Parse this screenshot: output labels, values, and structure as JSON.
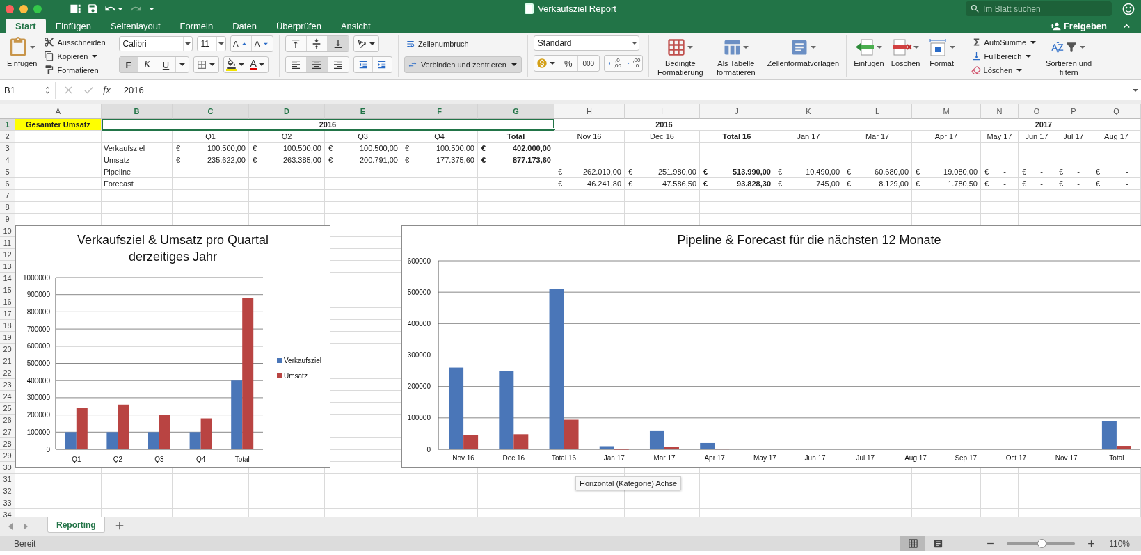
{
  "window": {
    "title": "Verkaufsziel Report"
  },
  "search": {
    "placeholder": "Im Blatt suchen"
  },
  "tabs": [
    {
      "label": "Start",
      "selected": true
    },
    {
      "label": "Einfügen",
      "selected": false
    },
    {
      "label": "Seitenlayout",
      "selected": false
    },
    {
      "label": "Formeln",
      "selected": false
    },
    {
      "label": "Daten",
      "selected": false
    },
    {
      "label": "Überprüfen",
      "selected": false
    },
    {
      "label": "Ansicht",
      "selected": false
    }
  ],
  "share": {
    "label": "Freigeben"
  },
  "ribbon": {
    "clipboard": {
      "paste": "Einfügen",
      "items": [
        {
          "label": "Ausschneiden",
          "kind": "plain"
        },
        {
          "label": "Kopieren",
          "kind": "menu"
        },
        {
          "label": "Formatieren",
          "kind": "plain"
        }
      ]
    },
    "font": {
      "name": "Calibri",
      "size": "11",
      "grow": "A",
      "shrink": "A",
      "styles": [
        {
          "label": "F",
          "selected": true
        },
        {
          "label": "K",
          "selected": false
        },
        {
          "label": "U",
          "selected": false
        }
      ],
      "font_color": "A"
    },
    "alignment": {
      "vertical": [
        {
          "selected": false
        },
        {
          "selected": false
        },
        {
          "selected": true
        }
      ],
      "horizontal": [
        {
          "selected": false
        },
        {
          "selected": true
        },
        {
          "selected": false
        }
      ]
    },
    "wrap": {
      "label": "Zeilenumbruch"
    },
    "merge": {
      "label": "Verbinden und zentrieren",
      "selected": true
    },
    "number": {
      "format": "Standard",
      "percent": "%",
      "thousands": "000",
      "decimals": [
        {
          "top": ",0",
          "bottom": ",00"
        },
        {
          "top": ",00",
          "bottom": ",0"
        }
      ]
    },
    "styles": [
      {
        "label": "Bedingte Formatierung"
      },
      {
        "label": "Als Tabelle formatieren"
      },
      {
        "label": "Zellenformatvorlagen"
      }
    ],
    "cells": [
      {
        "label": "Einfügen"
      },
      {
        "label": "Löschen"
      },
      {
        "label": "Format"
      }
    ],
    "editing": {
      "items": [
        {
          "label": "AutoSumme"
        },
        {
          "label": "Füllbereich"
        },
        {
          "label": "Löschen"
        }
      ],
      "sort": "Sortieren und filtern"
    }
  },
  "formula_bar": {
    "name_box": "B1",
    "fx": "fx",
    "value": "2016"
  },
  "sheet": {
    "columns": [
      {
        "label": "A",
        "selected": false
      },
      {
        "label": "B",
        "selected": true
      },
      {
        "label": "C",
        "selected": true
      },
      {
        "label": "D",
        "selected": true
      },
      {
        "label": "E",
        "selected": true
      },
      {
        "label": "F",
        "selected": true
      },
      {
        "label": "G",
        "selected": true
      },
      {
        "label": "H",
        "selected": false
      },
      {
        "label": "I",
        "selected": false
      },
      {
        "label": "J",
        "selected": false
      },
      {
        "label": "K",
        "selected": false
      },
      {
        "label": "L",
        "selected": false
      },
      {
        "label": "M",
        "selected": false
      },
      {
        "label": "N",
        "selected": false
      },
      {
        "label": "O",
        "selected": false
      },
      {
        "label": "P",
        "selected": false
      },
      {
        "label": "Q",
        "selected": false
      }
    ],
    "row_headers": [
      {
        "label": "1",
        "selected": true
      },
      {
        "label": "2",
        "selected": false
      },
      {
        "label": "3",
        "selected": false
      },
      {
        "label": "4",
        "selected": false
      },
      {
        "label": "5",
        "selected": false
      },
      {
        "label": "6",
        "selected": false
      },
      {
        "label": "7",
        "selected": false
      },
      {
        "label": "8",
        "selected": false
      },
      {
        "label": "9",
        "selected": false
      },
      {
        "label": "10",
        "selected": false
      },
      {
        "label": "11",
        "selected": false
      },
      {
        "label": "12",
        "selected": false
      },
      {
        "label": "13",
        "selected": false
      },
      {
        "label": "14",
        "selected": false
      },
      {
        "label": "15",
        "selected": false
      },
      {
        "label": "16",
        "selected": false
      },
      {
        "label": "17",
        "selected": false
      },
      {
        "label": "18",
        "selected": false
      },
      {
        "label": "19",
        "selected": false
      },
      {
        "label": "20",
        "selected": false
      },
      {
        "label": "21",
        "selected": false
      },
      {
        "label": "22",
        "selected": false
      },
      {
        "label": "23",
        "selected": false
      },
      {
        "label": "24",
        "selected": false
      },
      {
        "label": "25",
        "selected": false
      },
      {
        "label": "26",
        "selected": false
      },
      {
        "label": "27",
        "selected": false
      },
      {
        "label": "28",
        "selected": false
      },
      {
        "label": "29",
        "selected": false
      },
      {
        "label": "30",
        "selected": false
      },
      {
        "label": "31",
        "selected": false
      },
      {
        "label": "32",
        "selected": false
      },
      {
        "label": "33",
        "selected": false
      },
      {
        "label": "34",
        "selected": false
      }
    ],
    "band": {
      "label": "Gesamter Umsatz",
      "groups": [
        {
          "text": "2016",
          "selected": true
        },
        {
          "text": "2016",
          "selected": false
        },
        {
          "text": "2017",
          "selected": false
        }
      ]
    },
    "quarter_headers": [
      {
        "text": "Q1",
        "bold": false
      },
      {
        "text": "Q2",
        "bold": false
      },
      {
        "text": "Q3",
        "bold": false
      },
      {
        "text": "Q4",
        "bold": false
      },
      {
        "text": "Total",
        "bold": true
      }
    ],
    "month_headers": [
      {
        "text": "Nov 16",
        "bold": false
      },
      {
        "text": "Dec 16",
        "bold": false
      },
      {
        "text": "Total 16",
        "bold": true
      },
      {
        "text": "Jan 17",
        "bold": false
      },
      {
        "text": "Mar 17",
        "bold": false
      },
      {
        "text": "Apr 17",
        "bold": false
      },
      {
        "text": "May 17",
        "bold": false
      },
      {
        "text": "Jun 17",
        "bold": false
      },
      {
        "text": "Jul 17",
        "bold": false
      },
      {
        "text": "Aug 17",
        "bold": false
      }
    ],
    "rows": [
      {
        "label": "Verkaufsziel",
        "quarters": [
          {
            "kind": "amount",
            "currency": "€",
            "amount": "100.500,00",
            "bold": false
          },
          {
            "kind": "amount",
            "currency": "€",
            "amount": "100.500,00",
            "bold": false
          },
          {
            "kind": "amount",
            "currency": "€",
            "amount": "100.500,00",
            "bold": false
          },
          {
            "kind": "amount",
            "currency": "€",
            "amount": "100.500,00",
            "bold": false
          },
          {
            "kind": "amount",
            "currency": "€",
            "amount": "402.000,00",
            "bold": true
          }
        ]
      },
      {
        "label": "Umsatz",
        "quarters": [
          {
            "kind": "amount",
            "currency": "€",
            "amount": "235.622,00",
            "bold": false
          },
          {
            "kind": "amount",
            "currency": "€",
            "amount": "263.385,00",
            "bold": false
          },
          {
            "kind": "amount",
            "currency": "€",
            "amount": "200.791,00",
            "bold": false
          },
          {
            "kind": "amount",
            "currency": "€",
            "amount": "177.375,60",
            "bold": false
          },
          {
            "kind": "amount",
            "currency": "€",
            "amount": "877.173,60",
            "bold": true
          }
        ]
      },
      {
        "label": "Pipeline",
        "months": [
          {
            "kind": "amount",
            "currency": "€",
            "amount": "262.010,00",
            "bold": false
          },
          {
            "kind": "amount",
            "currency": "€",
            "amount": "251.980,00",
            "bold": false
          },
          {
            "kind": "amount",
            "currency": "€",
            "amount": "513.990,00",
            "bold": true
          },
          {
            "kind": "amount",
            "currency": "€",
            "amount": "10.490,00",
            "bold": false
          },
          {
            "kind": "amount",
            "currency": "€",
            "amount": "60.680,00",
            "bold": false
          },
          {
            "kind": "amount",
            "currency": "€",
            "amount": "19.080,00",
            "bold": false
          },
          {
            "kind": "nil",
            "currency": "€",
            "amount": "-",
            "bold": false
          },
          {
            "kind": "nil",
            "currency": "€",
            "amount": "-",
            "bold": false
          },
          {
            "kind": "nil",
            "currency": "€",
            "amount": "-",
            "bold": false
          },
          {
            "kind": "nil",
            "currency": "€",
            "amount": "-",
            "bold": false
          }
        ]
      },
      {
        "label": "Forecast",
        "months": [
          {
            "kind": "amount",
            "currency": "€",
            "amount": "46.241,80",
            "bold": false
          },
          {
            "kind": "amount",
            "currency": "€",
            "amount": "47.586,50",
            "bold": false
          },
          {
            "kind": "amount",
            "currency": "€",
            "amount": "93.828,30",
            "bold": true
          },
          {
            "kind": "amount",
            "currency": "€",
            "amount": "745,00",
            "bold": false
          },
          {
            "kind": "amount",
            "currency": "€",
            "amount": "8.129,00",
            "bold": false
          },
          {
            "kind": "amount",
            "currency": "€",
            "amount": "1.780,50",
            "bold": false
          },
          {
            "kind": "nil",
            "currency": "€",
            "amount": "-",
            "bold": false
          },
          {
            "kind": "nil",
            "currency": "€",
            "amount": "-",
            "bold": false
          },
          {
            "kind": "nil",
            "currency": "€",
            "amount": "-",
            "bold": false
          },
          {
            "kind": "nil",
            "currency": "€",
            "amount": "-",
            "bold": false
          }
        ]
      }
    ]
  },
  "charts": [
    {
      "chart_data": {
        "type": "bar",
        "title": "Verkaufsziel & Umsatz pro Quartal derzeitiges Jahr",
        "categories": [
          "Q1",
          "Q2",
          "Q3",
          "Q4",
          "Total"
        ],
        "series": [
          {
            "name": "Verkaufsziel",
            "color": "#4a76b8",
            "values": [
              100000,
              100000,
              100000,
              100000,
              400000
            ]
          },
          {
            "name": "Umsatz",
            "color": "#b94442",
            "values": [
              240000,
              260000,
              200000,
              180000,
              880000
            ]
          }
        ],
        "ylim": [
          0,
          1000000
        ],
        "yticks": [
          0,
          100000,
          200000,
          300000,
          400000,
          500000,
          600000,
          700000,
          800000,
          900000,
          1000000
        ],
        "grid": true,
        "legend": true
      }
    },
    {
      "chart_data": {
        "type": "bar",
        "title": "Pipeline & Forecast für die nächsten 12 Monate",
        "categories": [
          "Nov 16",
          "Dec 16",
          "Total 16",
          "Jan 17",
          "Mar 17",
          "Apr 17",
          "May 17",
          "Jun 17",
          "Jul 17",
          "Aug 17",
          "Sep 17",
          "Oct 17",
          "Nov 17",
          "Total"
        ],
        "series": [
          {
            "color": "#4a76b8",
            "values": [
              260000,
              250000,
              510000,
              10000,
              60000,
              20000,
              0,
              0,
              0,
              0,
              0,
              0,
              0,
              90000
            ]
          },
          {
            "color": "#b94442",
            "values": [
              46000,
              48000,
              94000,
              1000,
              8000,
              2000,
              0,
              0,
              0,
              0,
              0,
              0,
              0,
              11000
            ]
          }
        ],
        "ylim": [
          0,
          600000
        ],
        "yticks": [
          0,
          100000,
          200000,
          300000,
          400000,
          500000,
          600000
        ],
        "grid": true
      }
    }
  ],
  "tooltip": "Horizontal (Kategorie) Achse",
  "sheet_tabs": [
    {
      "label": "Reporting",
      "selected": true
    }
  ],
  "status_bar": {
    "status": "Bereit",
    "views": [
      {
        "selected": true
      },
      {
        "selected": false
      }
    ],
    "zoom": {
      "level": 0.51,
      "reading": "110%"
    }
  }
}
